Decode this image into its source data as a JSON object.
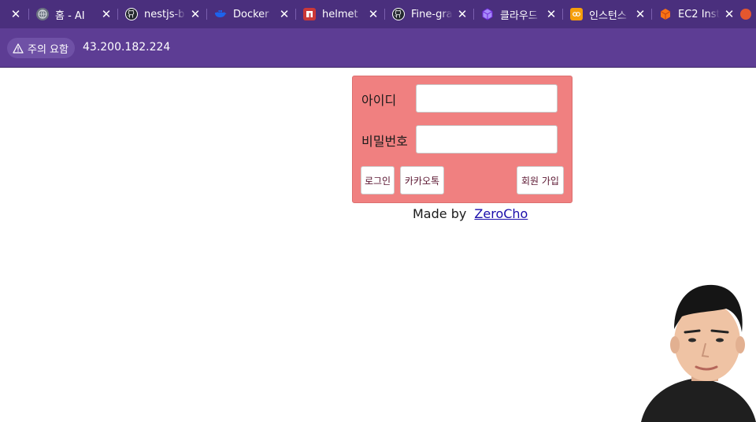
{
  "browser": {
    "tabs": [
      {
        "title": "홈 - AI",
        "favicon": "globe-icon",
        "color": "#6b7280"
      },
      {
        "title": "nestjs-b",
        "favicon": "github-icon",
        "color": "#24292f"
      },
      {
        "title": "Docker",
        "favicon": "docker-icon",
        "color": "#1d63ed"
      },
      {
        "title": "helmet",
        "favicon": "npm-icon",
        "color": "#cb3837"
      },
      {
        "title": "Fine-gra",
        "favicon": "github-icon",
        "color": "#24292f"
      },
      {
        "title": "클라우드",
        "favicon": "cube-icon",
        "color": "#8b5cf6"
      },
      {
        "title": "인스턴스",
        "favicon": "aws-icon",
        "color": "#f59e0b"
      },
      {
        "title": "EC2 Inst",
        "favicon": "aws-ec2-icon",
        "color": "#f97316"
      }
    ],
    "close_glyph": "✕",
    "security_warning": "주의 요함",
    "address": "43.200.182.224"
  },
  "login": {
    "id_label": "아이디",
    "id_value": "",
    "password_label": "비밀번호",
    "password_value": "",
    "login_button": "로그인",
    "kakao_button": "카카오톡",
    "join_button": "회원 가입",
    "background": "#f08080"
  },
  "footer": {
    "made_by": "Made by",
    "author_link": "ZeroCho"
  }
}
